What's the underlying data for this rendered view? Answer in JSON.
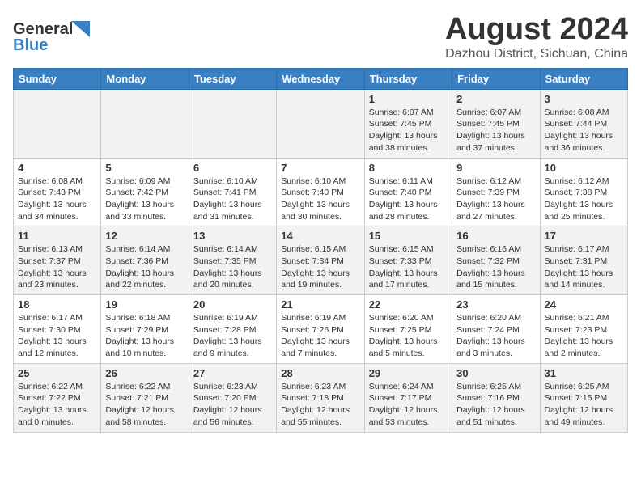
{
  "header": {
    "logo_general": "General",
    "logo_blue": "Blue",
    "month_year": "August 2024",
    "location": "Dazhou District, Sichuan, China"
  },
  "days_of_week": [
    "Sunday",
    "Monday",
    "Tuesday",
    "Wednesday",
    "Thursday",
    "Friday",
    "Saturday"
  ],
  "weeks": [
    [
      {
        "day": "",
        "info": ""
      },
      {
        "day": "",
        "info": ""
      },
      {
        "day": "",
        "info": ""
      },
      {
        "day": "",
        "info": ""
      },
      {
        "day": "1",
        "info": "Sunrise: 6:07 AM\nSunset: 7:45 PM\nDaylight: 13 hours\nand 38 minutes."
      },
      {
        "day": "2",
        "info": "Sunrise: 6:07 AM\nSunset: 7:45 PM\nDaylight: 13 hours\nand 37 minutes."
      },
      {
        "day": "3",
        "info": "Sunrise: 6:08 AM\nSunset: 7:44 PM\nDaylight: 13 hours\nand 36 minutes."
      }
    ],
    [
      {
        "day": "4",
        "info": "Sunrise: 6:08 AM\nSunset: 7:43 PM\nDaylight: 13 hours\nand 34 minutes."
      },
      {
        "day": "5",
        "info": "Sunrise: 6:09 AM\nSunset: 7:42 PM\nDaylight: 13 hours\nand 33 minutes."
      },
      {
        "day": "6",
        "info": "Sunrise: 6:10 AM\nSunset: 7:41 PM\nDaylight: 13 hours\nand 31 minutes."
      },
      {
        "day": "7",
        "info": "Sunrise: 6:10 AM\nSunset: 7:40 PM\nDaylight: 13 hours\nand 30 minutes."
      },
      {
        "day": "8",
        "info": "Sunrise: 6:11 AM\nSunset: 7:40 PM\nDaylight: 13 hours\nand 28 minutes."
      },
      {
        "day": "9",
        "info": "Sunrise: 6:12 AM\nSunset: 7:39 PM\nDaylight: 13 hours\nand 27 minutes."
      },
      {
        "day": "10",
        "info": "Sunrise: 6:12 AM\nSunset: 7:38 PM\nDaylight: 13 hours\nand 25 minutes."
      }
    ],
    [
      {
        "day": "11",
        "info": "Sunrise: 6:13 AM\nSunset: 7:37 PM\nDaylight: 13 hours\nand 23 minutes."
      },
      {
        "day": "12",
        "info": "Sunrise: 6:14 AM\nSunset: 7:36 PM\nDaylight: 13 hours\nand 22 minutes."
      },
      {
        "day": "13",
        "info": "Sunrise: 6:14 AM\nSunset: 7:35 PM\nDaylight: 13 hours\nand 20 minutes."
      },
      {
        "day": "14",
        "info": "Sunrise: 6:15 AM\nSunset: 7:34 PM\nDaylight: 13 hours\nand 19 minutes."
      },
      {
        "day": "15",
        "info": "Sunrise: 6:15 AM\nSunset: 7:33 PM\nDaylight: 13 hours\nand 17 minutes."
      },
      {
        "day": "16",
        "info": "Sunrise: 6:16 AM\nSunset: 7:32 PM\nDaylight: 13 hours\nand 15 minutes."
      },
      {
        "day": "17",
        "info": "Sunrise: 6:17 AM\nSunset: 7:31 PM\nDaylight: 13 hours\nand 14 minutes."
      }
    ],
    [
      {
        "day": "18",
        "info": "Sunrise: 6:17 AM\nSunset: 7:30 PM\nDaylight: 13 hours\nand 12 minutes."
      },
      {
        "day": "19",
        "info": "Sunrise: 6:18 AM\nSunset: 7:29 PM\nDaylight: 13 hours\nand 10 minutes."
      },
      {
        "day": "20",
        "info": "Sunrise: 6:19 AM\nSunset: 7:28 PM\nDaylight: 13 hours\nand 9 minutes."
      },
      {
        "day": "21",
        "info": "Sunrise: 6:19 AM\nSunset: 7:26 PM\nDaylight: 13 hours\nand 7 minutes."
      },
      {
        "day": "22",
        "info": "Sunrise: 6:20 AM\nSunset: 7:25 PM\nDaylight: 13 hours\nand 5 minutes."
      },
      {
        "day": "23",
        "info": "Sunrise: 6:20 AM\nSunset: 7:24 PM\nDaylight: 13 hours\nand 3 minutes."
      },
      {
        "day": "24",
        "info": "Sunrise: 6:21 AM\nSunset: 7:23 PM\nDaylight: 13 hours\nand 2 minutes."
      }
    ],
    [
      {
        "day": "25",
        "info": "Sunrise: 6:22 AM\nSunset: 7:22 PM\nDaylight: 13 hours\nand 0 minutes."
      },
      {
        "day": "26",
        "info": "Sunrise: 6:22 AM\nSunset: 7:21 PM\nDaylight: 12 hours\nand 58 minutes."
      },
      {
        "day": "27",
        "info": "Sunrise: 6:23 AM\nSunset: 7:20 PM\nDaylight: 12 hours\nand 56 minutes."
      },
      {
        "day": "28",
        "info": "Sunrise: 6:23 AM\nSunset: 7:18 PM\nDaylight: 12 hours\nand 55 minutes."
      },
      {
        "day": "29",
        "info": "Sunrise: 6:24 AM\nSunset: 7:17 PM\nDaylight: 12 hours\nand 53 minutes."
      },
      {
        "day": "30",
        "info": "Sunrise: 6:25 AM\nSunset: 7:16 PM\nDaylight: 12 hours\nand 51 minutes."
      },
      {
        "day": "31",
        "info": "Sunrise: 6:25 AM\nSunset: 7:15 PM\nDaylight: 12 hours\nand 49 minutes."
      }
    ]
  ]
}
